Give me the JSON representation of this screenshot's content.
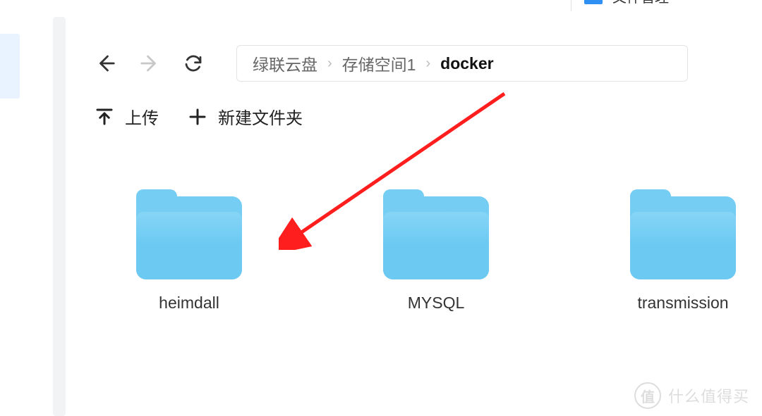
{
  "topTab": {
    "label": "文件管理"
  },
  "nav": {
    "back_enabled": true,
    "forward_enabled": false
  },
  "breadcrumb": {
    "items": [
      {
        "label": "绿联云盘",
        "current": false
      },
      {
        "label": "存储空间1",
        "current": false
      },
      {
        "label": "docker",
        "current": true
      }
    ]
  },
  "actions": {
    "upload_label": "上传",
    "new_folder_label": "新建文件夹"
  },
  "files": [
    {
      "name": "heimdall"
    },
    {
      "name": "MYSQL"
    },
    {
      "name": "transmission"
    }
  ],
  "watermark": {
    "badge": "值",
    "text": "什么值得买"
  }
}
